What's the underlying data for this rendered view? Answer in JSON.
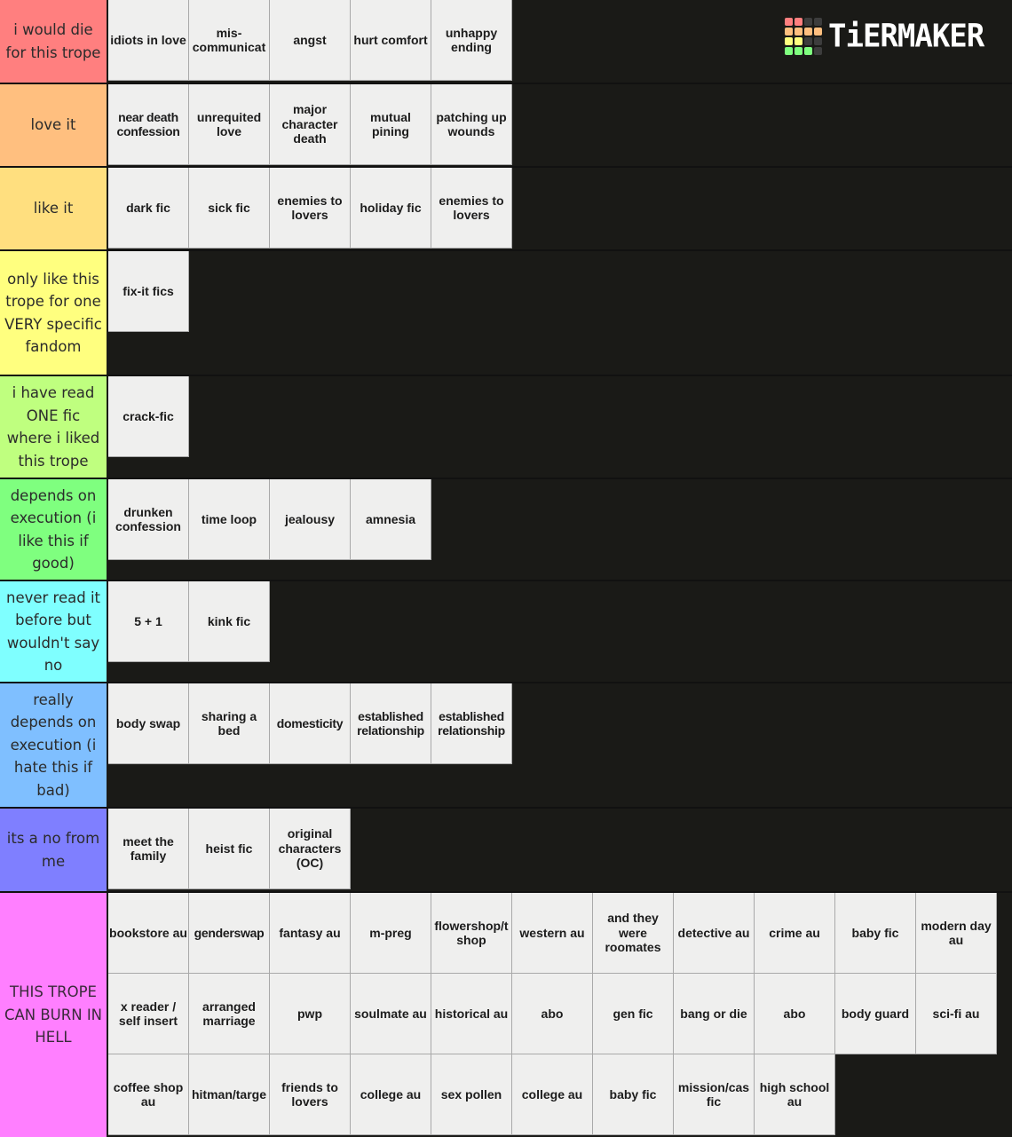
{
  "brand": {
    "name": "TiERMAKER",
    "logo_grid_colors": [
      "#ff7f7f",
      "#ff7f7f",
      "#3d3d3d",
      "#3d3d3d",
      "#ffbf7f",
      "#ffbf7f",
      "#ffbf7f",
      "#ffbf7f",
      "#ffff7f",
      "#ffff7f",
      "#3d3d3d",
      "#3d3d3d",
      "#7fff7f",
      "#7fff7f",
      "#7fff7f",
      "#3d3d3d"
    ]
  },
  "tiers": [
    {
      "label": "i would die for this trope",
      "color": "#ff7f7f",
      "items": [
        "idiots in love",
        "mis-communicat",
        "angst",
        "hurt comfort",
        "unhappy ending"
      ]
    },
    {
      "label": "love it",
      "color": "#ffbf7f",
      "items": [
        "near death confession",
        "unrequited love",
        "major character death",
        "mutual pining",
        "patching up wounds"
      ]
    },
    {
      "label": "like it",
      "color": "#ffdf7f",
      "items": [
        "dark fic",
        "sick fic",
        "enemies to lovers",
        "holiday fic",
        "enemies to lovers"
      ]
    },
    {
      "label": "only like this trope for one VERY specific fandom",
      "color": "#ffff7f",
      "items": [
        "fix-it fics"
      ]
    },
    {
      "label": "i have read ONE fic where i liked this trope",
      "color": "#bfff7f",
      "items": [
        "crack-fic"
      ]
    },
    {
      "label": "depends on execution (i like this if good)",
      "color": "#7fff7f",
      "items": [
        "drunken confession",
        "time loop",
        "jealousy",
        "amnesia"
      ]
    },
    {
      "label": "never read it before but wouldn't say no",
      "color": "#7fffff",
      "items": [
        "5 + 1",
        "kink fic"
      ]
    },
    {
      "label": "really depends on execution (i hate this if bad)",
      "color": "#7fbfff",
      "items": [
        "body swap",
        "sharing a bed",
        "domesticity",
        "established relationship",
        "established relationship"
      ]
    },
    {
      "label": "its a no from me",
      "color": "#7f7fff",
      "items": [
        "meet the family",
        "heist fic",
        "original characters (OC)"
      ]
    },
    {
      "label": "THIS TROPE CAN BURN IN HELL",
      "color": "#ff7fff",
      "items": [
        "bookstore au",
        "genderswap",
        "fantasy au",
        "m-preg",
        "flowershop/tattoo shop",
        "western au",
        "and they were roomates",
        "detective au",
        "crime au",
        "baby fic",
        "modern day au",
        "x reader / self insert",
        "arranged marriage",
        "pwp",
        "soulmate au",
        "historical au",
        "abo",
        "gen fic",
        "bang or die",
        "abo",
        "body guard",
        "sci-fi au",
        "coffee shop au",
        "hitman/target",
        "friends to lovers",
        "college au",
        "sex pollen",
        "college au",
        "baby fic",
        "mission/case fic",
        "high school au"
      ]
    }
  ]
}
